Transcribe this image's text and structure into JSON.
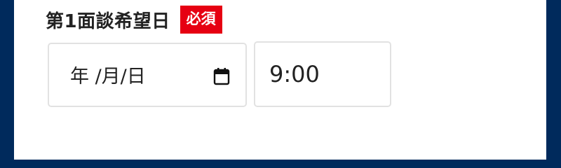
{
  "form": {
    "field_label": "第1面談希望日",
    "required_badge": "必須",
    "date_input": {
      "placeholder": "年 /月/日",
      "icon": "calendar-icon"
    },
    "time_input": {
      "value": "9:00"
    }
  },
  "colors": {
    "page_background": "#002a5c",
    "panel_background": "#ffffff",
    "required_badge": "#e60012",
    "input_border": "#e2e2e2",
    "text": "#222222"
  }
}
